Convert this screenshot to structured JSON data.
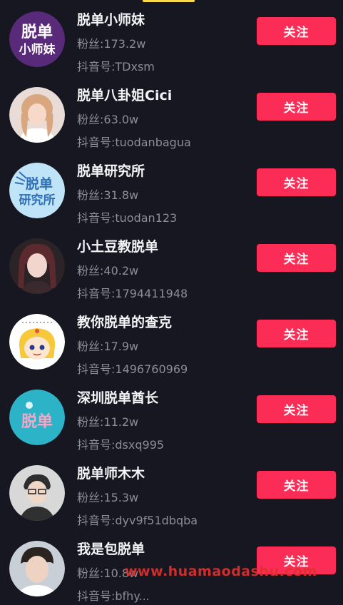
{
  "follow_label": "关注",
  "watermark": "www.huamaodashu.com",
  "accounts": [
    {
      "name": "脱单小师妹",
      "fans": "粉丝:173.2w",
      "douyin_id": "抖音号:TDxsm",
      "avatar_text": [
        "脱单",
        "小师妹"
      ]
    },
    {
      "name": "脱单八卦姐Cici",
      "fans": "粉丝:63.0w",
      "douyin_id": "抖音号:tuodanbagua"
    },
    {
      "name": "脱单研究所",
      "fans": "粉丝:31.8w",
      "douyin_id": "抖音号:tuodan123",
      "avatar_text": [
        "脱单",
        "研究所"
      ]
    },
    {
      "name": "小土豆教脱单",
      "fans": "粉丝:40.2w",
      "douyin_id": "抖音号:1794411948"
    },
    {
      "name": "教你脱单的查克",
      "fans": "粉丝:17.9w",
      "douyin_id": "抖音号:1496760969"
    },
    {
      "name": "深圳脱单酋长",
      "fans": "粉丝:11.2w",
      "douyin_id": "抖音号:dsxq995",
      "avatar_text": [
        "脱单"
      ]
    },
    {
      "name": "脱单师木木",
      "fans": "粉丝:15.3w",
      "douyin_id": "抖音号:dyv9f51dbqba"
    },
    {
      "name": "我是包脱单",
      "fans": "粉丝:10.8w",
      "douyin_id": "抖音号:bfhy..."
    }
  ]
}
